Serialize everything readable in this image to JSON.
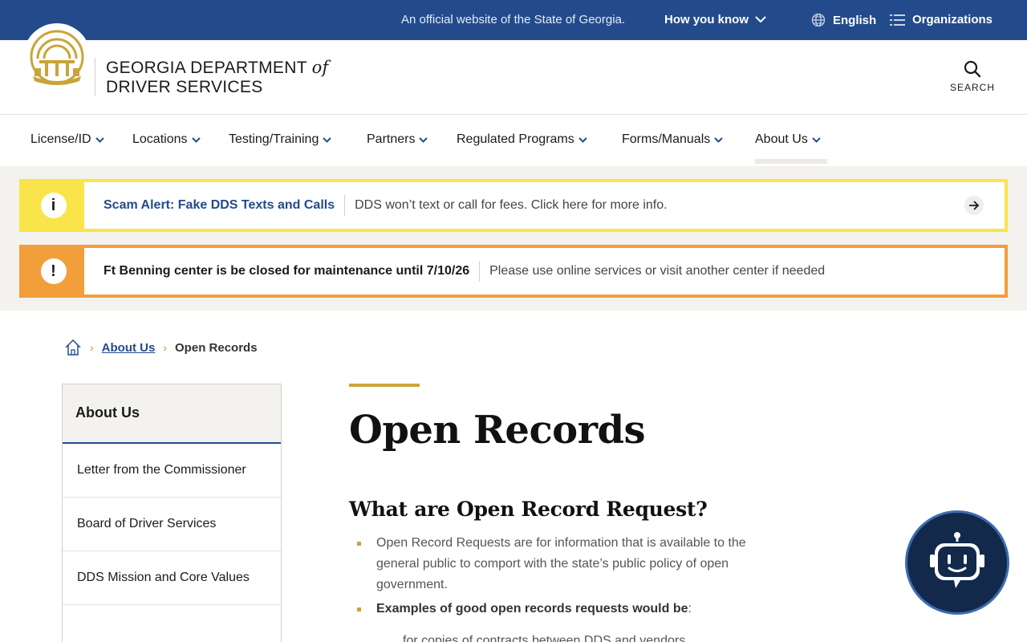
{
  "topbar": {
    "official_text": "An official website of the State of Georgia.",
    "how_you_know": "How you know",
    "language": "English",
    "organizations": "Organizations"
  },
  "header": {
    "brand_line1": "GEORGIA DEPARTMENT",
    "brand_of": "of",
    "brand_line2": "DRIVER SERVICES",
    "search_label": "SEARCH"
  },
  "nav": {
    "items": [
      {
        "label": "License/ID"
      },
      {
        "label": "Locations"
      },
      {
        "label": "Testing/Training"
      },
      {
        "label": "Partners"
      },
      {
        "label": "Regulated Programs"
      },
      {
        "label": "Forms/Manuals"
      },
      {
        "label": "About Us"
      }
    ],
    "active": "About Us"
  },
  "alerts": [
    {
      "icon": "i",
      "title": "Scam Alert: Fake DDS Texts and Calls",
      "message": "DDS won’t text or call for fees. Click here for more info.",
      "color": "#f9e44a"
    },
    {
      "icon": "!",
      "title": "Ft Benning center is be closed for maintenance until 7/10/26",
      "message": "Please use online services or visit another center if needed",
      "color": "#f29e3a"
    }
  ],
  "breadcrumb": {
    "parent": "About Us",
    "current": "Open Records"
  },
  "sidenav": {
    "heading": "About Us",
    "items": [
      {
        "label": "Letter from the Commissioner"
      },
      {
        "label": "Board of Driver Services"
      },
      {
        "label": "DDS Mission and Core Values"
      }
    ]
  },
  "main": {
    "title": "Open Records",
    "section_title": "What are Open Record Request?",
    "bullet1": "Open Record Requests are for information that is available to the general public to comport with the state’s public policy of open government.",
    "bullet2_strong": "Examples of good open records requests would be",
    "bullet2_tail": ":",
    "sub_bullet": "for copies of contracts between DDS and vendors"
  },
  "colors": {
    "brand_blue": "#234b8c",
    "gold": "#c9a43a",
    "alert_yellow": "#f9e44a",
    "alert_orange": "#f29e3a",
    "chatbot_navy": "#12294b"
  }
}
